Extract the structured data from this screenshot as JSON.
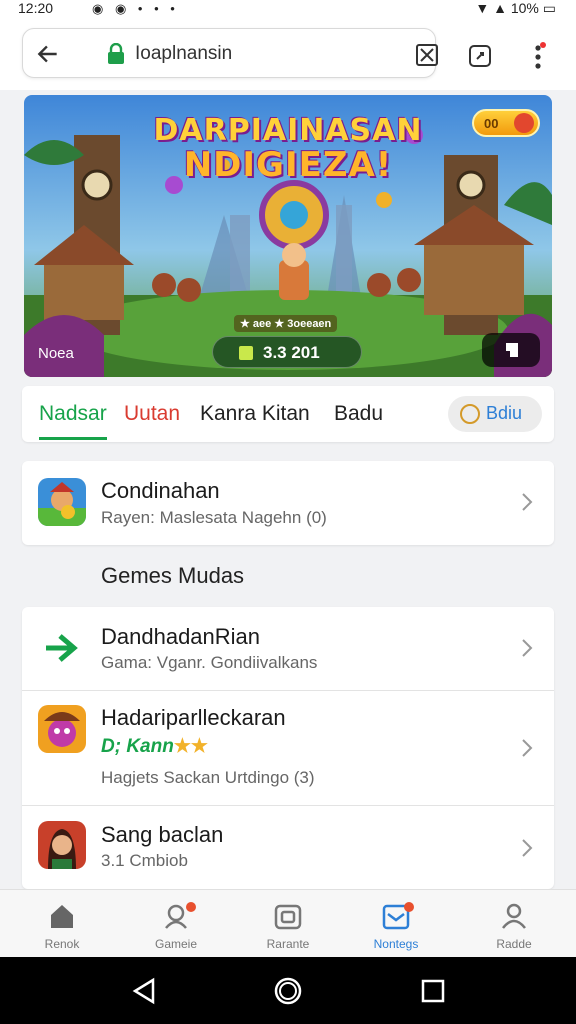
{
  "status_bar": {
    "time": "12:20",
    "battery": "10%"
  },
  "browser": {
    "url": "Ioaplnansin"
  },
  "hero": {
    "title_line1": "DARPIAINASAN",
    "title_line2": "NDIGIEZA!",
    "coin_value": "00",
    "sub_tag": "★ aee ★ 3oeeaen",
    "score": "3.3 201",
    "label": "Noea"
  },
  "filters": {
    "items": [
      "Nadsar",
      "Uutan",
      "Kanra Kitan",
      "Badu"
    ],
    "button_label": "Bdiu"
  },
  "featured": {
    "title": "Condinahan",
    "subtitle": "Rayen: Maslesata Nagehn (0)"
  },
  "section_title": "Gemes Mudas",
  "list": [
    {
      "title": "DandhadanRian",
      "subtitle": "Gama: Vganr. Gondiivalkans"
    },
    {
      "title": "Hadariparlleckaran",
      "tag": "D; Kann",
      "subtitle": "Hagjets Sackan Urtdingo (3)"
    },
    {
      "title": "Sang baclan",
      "subtitle": "3.1 Cmbiob"
    }
  ],
  "bottom_nav": [
    {
      "label": "Renok",
      "icon": "home-icon"
    },
    {
      "label": "Gameie",
      "icon": "games-icon"
    },
    {
      "label": "Rarante",
      "icon": "camera-icon"
    },
    {
      "label": "Nontegs",
      "icon": "inbox-icon"
    },
    {
      "label": "Radde",
      "icon": "profile-icon"
    }
  ],
  "colors": {
    "accent_green": "#17a34a",
    "accent_red": "#d93b30",
    "accent_blue": "#2d7fd6"
  }
}
